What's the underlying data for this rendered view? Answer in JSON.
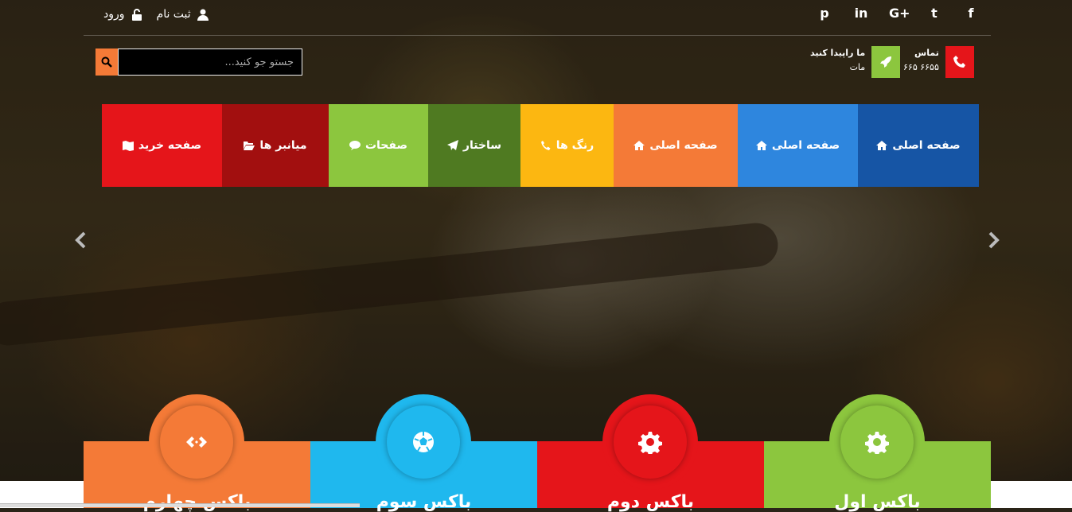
{
  "topbar": {
    "auth": {
      "login": "ورود",
      "register": "ثبت نام"
    },
    "social": [
      "f",
      "t",
      "G+",
      "in",
      "p"
    ]
  },
  "search": {
    "placeholder": "جستو جو کنید..."
  },
  "contact": {
    "phone_title": "تماس",
    "phone_value": "۶۶۵ ۶۶۵۵",
    "find_title": "ما راپیدا کنید",
    "find_value": "مات"
  },
  "nav": [
    {
      "label": "صفحه اصلی",
      "color": "#1655a5",
      "icon": "home-icon"
    },
    {
      "label": "صفحه اصلی",
      "color": "#2e86de",
      "icon": "home-icon"
    },
    {
      "label": "صفحه اصلی",
      "color": "#f47a37",
      "icon": "home-icon"
    },
    {
      "label": "رنگ ها",
      "color": "#fcb711",
      "icon": "phone-icon"
    },
    {
      "label": "ساختار",
      "color": "#4f7a21",
      "icon": "paper-plane-icon"
    },
    {
      "label": "صفحات",
      "color": "#8cc63e",
      "icon": "comment-icon"
    },
    {
      "label": "میانبر ها",
      "color": "#a20f0f",
      "icon": "folder-open-icon"
    },
    {
      "label": "صفحه خرید",
      "color": "#e5151a",
      "icon": "map-icon"
    }
  ],
  "boxes": [
    {
      "title": "باکس اول",
      "color": "#8cc63e",
      "icon": "gear-icon"
    },
    {
      "title": "باکس دوم",
      "color": "#e5151a",
      "icon": "gear-icon"
    },
    {
      "title": "باکس سوم",
      "color": "#1fb8ee",
      "icon": "soccer-ball-icon"
    },
    {
      "title": "باکس چهارم",
      "color": "#f47a37",
      "icon": "code-icon"
    }
  ]
}
